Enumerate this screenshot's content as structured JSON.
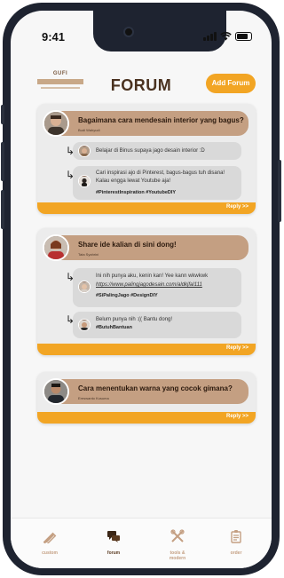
{
  "status": {
    "time": "9:41"
  },
  "header": {
    "logo_text": "GUFI",
    "title": "FORUM",
    "add_button": "Add Forum"
  },
  "threads": [
    {
      "question": "Bagaimana cara mendesain interior yang bagus?",
      "author": "Budi Wahyudi",
      "replies": [
        {
          "text": "Belajar di Binus supaya jago desain interior :D",
          "tags": ""
        },
        {
          "text": "Cari inspirasi ajo di Pinterest, bagus-bagus tuh disana! Kalau engga lewat Youtube aja!",
          "tags": "#PinterestInspiration #YoutubeDIY"
        }
      ],
      "reply_link": "Reply >>"
    },
    {
      "question": "Share ide kalian di sini dong!",
      "author": "Tata Syahrini",
      "replies": [
        {
          "text": "Ini nih punya aku, kenin kan! Yee kann wkwkwk",
          "link": "https://www.palingjagodesain.com/aldkjfal111",
          "tags": "#SiPalingJago #DesignDIY"
        },
        {
          "text": "Belum punya nih :(( Bantu dong!",
          "tags": "#ButuhBantuan"
        }
      ],
      "reply_link": "Reply >>"
    },
    {
      "question": "Cara menentukan warna yang cocok gimana?",
      "author": "Ereswanto Kusuma",
      "replies": [],
      "reply_link": "Reply >>"
    }
  ],
  "tabs": [
    {
      "label": "custom",
      "icon": "pencil-ruler-icon"
    },
    {
      "label": "forum",
      "icon": "chat-bubbles-icon"
    },
    {
      "label": "tools & modern",
      "icon": "tools-icon"
    },
    {
      "label": "order",
      "icon": "clipboard-icon"
    }
  ],
  "colors": {
    "accent": "#f2a524",
    "brown": "#c49f82",
    "title": "#4a3220"
  }
}
